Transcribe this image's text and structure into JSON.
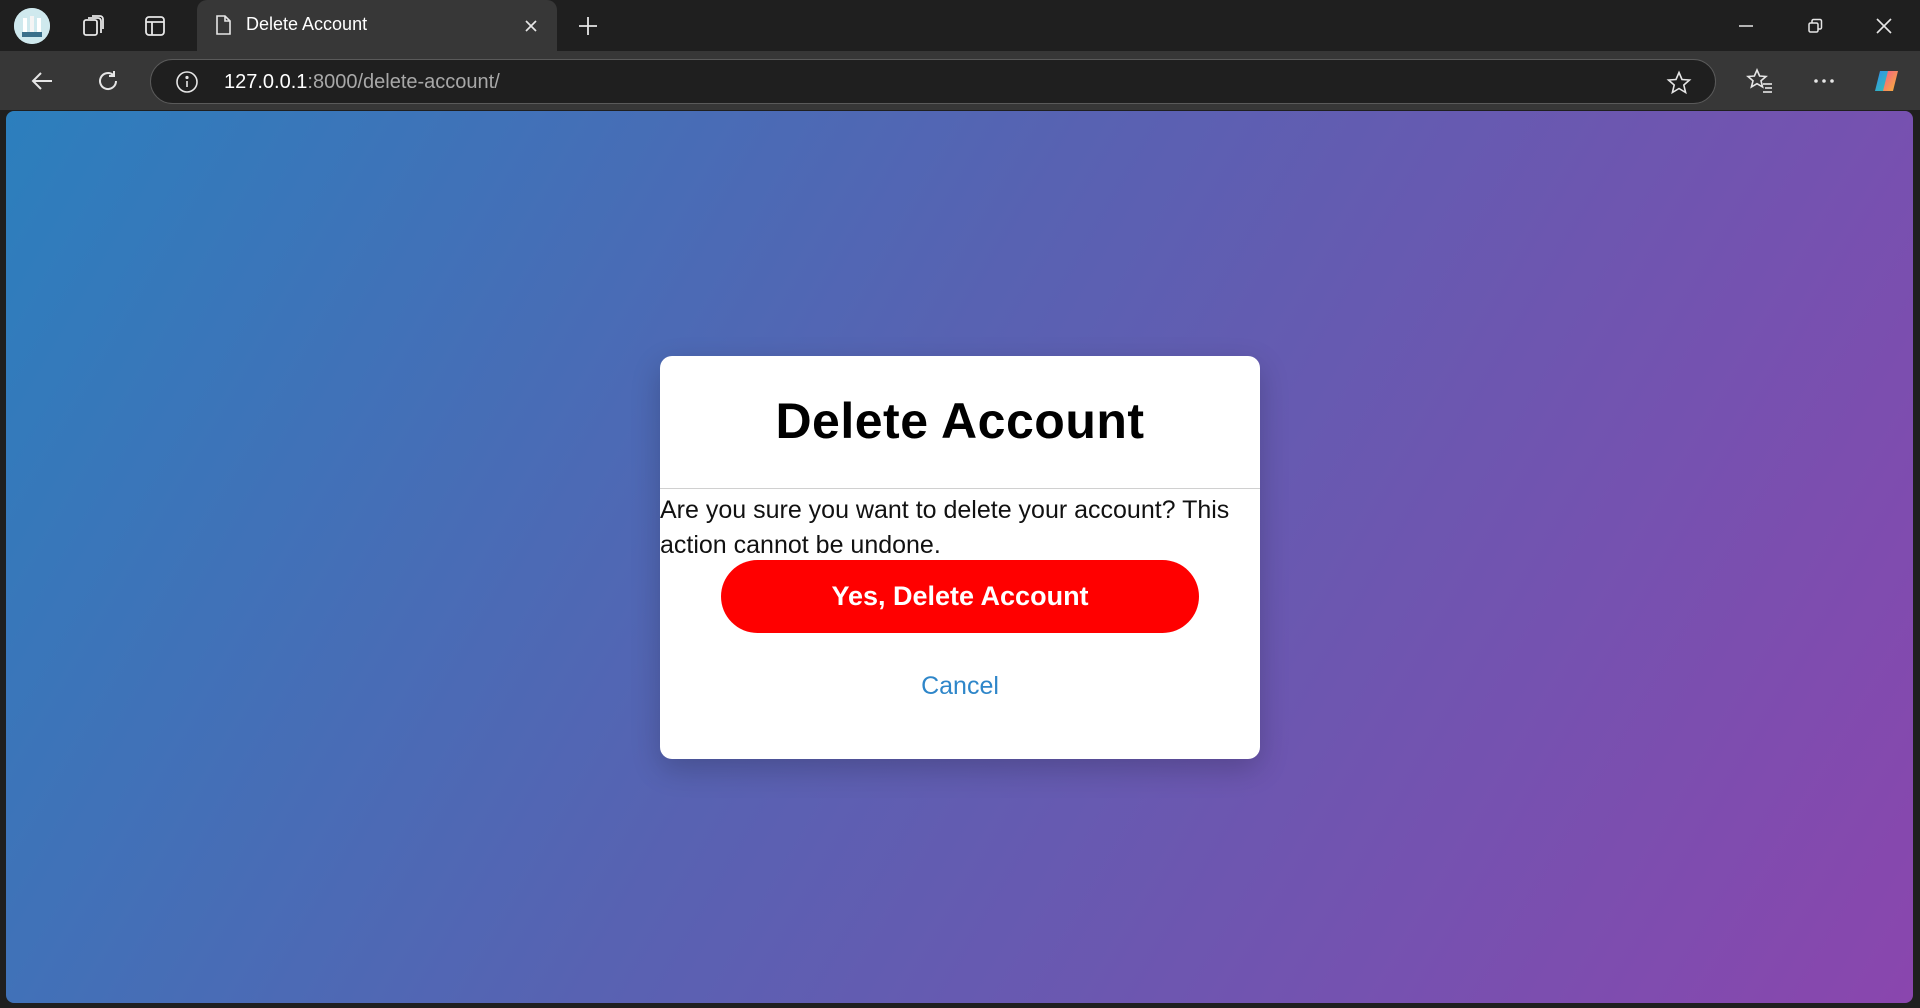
{
  "browser": {
    "tab_title": "Delete Account",
    "url_host": "127.0.0.1",
    "url_rest": ":8000/delete-account/",
    "icons": [
      "profile-avatar",
      "workspaces-icon",
      "tab-actions-icon",
      "page-icon",
      "close-icon",
      "plus-icon",
      "minimize-icon",
      "restore-icon",
      "close-window-icon",
      "back-arrow-icon",
      "reload-icon",
      "info-icon",
      "star-icon",
      "favorites-icon",
      "more-icon",
      "copilot-icon"
    ]
  },
  "page": {
    "background_colors": [
      "#2c7fbd",
      "#8a46ae"
    ],
    "modal": {
      "title": "Delete Account",
      "message": "Are you sure you want to delete your account? This action cannot be undone.",
      "confirm_label": "Yes, Delete Account",
      "confirm_color": "#ff0000",
      "cancel_label": "Cancel",
      "cancel_color": "#2e86c9"
    }
  }
}
